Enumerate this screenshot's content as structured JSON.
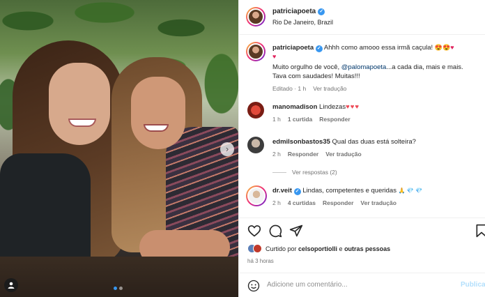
{
  "post": {
    "username": "patriciapoeta",
    "location": "Rio De Janeiro, Brazil"
  },
  "caption": {
    "username": "patriciapoeta",
    "text_1": " Ahhh como amooo essa irmã caçula! ",
    "emojis_1": "😍😍♥",
    "emojis_2": "♥",
    "text_2": "Muito orgulho de você, ",
    "mention": "@palomapoeta",
    "text_3": "...a cada dia, mais e mais.",
    "text_4": "Tava com saudades! Muitas!!!",
    "edited": "Editado · 1 h",
    "translate": "Ver tradução"
  },
  "comments": [
    {
      "username": "manomadison",
      "text": " Lindezas",
      "hearts": "♥♥♥",
      "time": "1 h",
      "likes": "1 curtida",
      "reply": "Responder"
    },
    {
      "username": "edmilsonbastos35",
      "text": " Qual das duas está solteira?",
      "time": "2 h",
      "reply": "Responder",
      "translate": "Ver tradução",
      "view_replies": "Ver respostas (2)"
    },
    {
      "username": "dr.veit",
      "text": " Lindas, competentes e queridas ",
      "emojis": "🙏 💎 💎",
      "time": "2 h",
      "likes": "4 curtidas",
      "reply": "Responder",
      "translate": "Ver tradução"
    }
  ],
  "likes": {
    "prefix": "Curtido por ",
    "user": "celsoportiolli",
    "suffix": " e ",
    "others": "outras pessoas"
  },
  "timestamp": "há 3 horas",
  "add_comment": {
    "placeholder": "Adicione um comentário...",
    "publish": "Publicar"
  },
  "icons": [
    "heart-icon",
    "comment-icon",
    "share-icon",
    "save-icon",
    "emoji-icon",
    "chevron-right-icon",
    "user-tag-icon",
    "verified-icon"
  ],
  "colors": {
    "verified": "#3897f0",
    "heart": "#ed4956",
    "link": "#00376b",
    "muted": "#737373"
  }
}
